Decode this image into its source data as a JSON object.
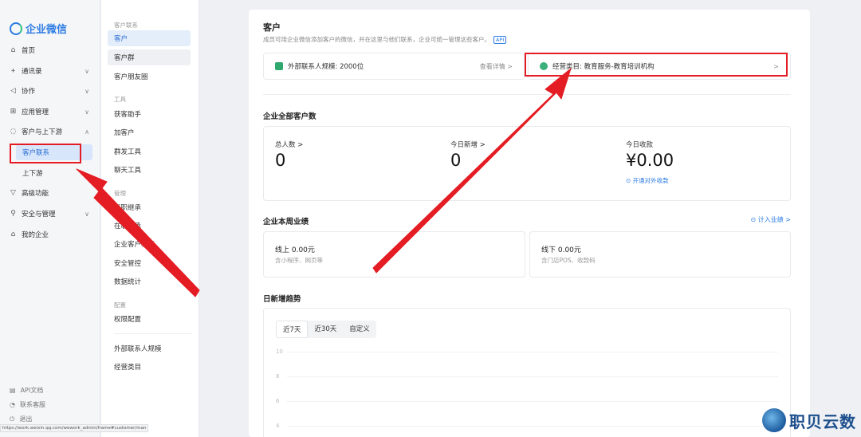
{
  "nav": {
    "logo": "企业微信",
    "items": [
      {
        "icon": "home-icon",
        "glyph": "⌂",
        "label": "首页"
      },
      {
        "icon": "org-icon",
        "glyph": "ᚐ",
        "label": "通讯录",
        "chev": "∨"
      },
      {
        "icon": "collab-icon",
        "glyph": "◁",
        "label": "协作",
        "chev": "∨"
      },
      {
        "icon": "apps-icon",
        "glyph": "⊞",
        "label": "应用管理",
        "chev": "∨"
      },
      {
        "icon": "chat-icon",
        "glyph": "◌",
        "label": "客户与上下游",
        "chev": "∧"
      }
    ],
    "sub_items": [
      "客户联系",
      "上下游"
    ],
    "items2": [
      {
        "icon": "advanced-icon",
        "glyph": "▽",
        "label": "高级功能"
      },
      {
        "icon": "security-icon",
        "glyph": "⚲",
        "label": "安全与管理",
        "chev": "∨"
      },
      {
        "icon": "company-icon",
        "glyph": "⌂",
        "label": "我的企业"
      }
    ],
    "footer": [
      {
        "icon": "doc-icon",
        "glyph": "▤",
        "label": "API文档"
      },
      {
        "icon": "service-icon",
        "glyph": "◔",
        "label": "联系客服"
      },
      {
        "icon": "logout-icon",
        "glyph": "⏻",
        "label": "退出"
      }
    ]
  },
  "sub": {
    "section1": "客户联系",
    "items1": [
      "客户",
      "客户群",
      "客户朋友圈"
    ],
    "section2": "工具",
    "items2": [
      "获客助手",
      "加客户",
      "群发工具",
      "聊天工具"
    ],
    "section3": "管理",
    "items3": [
      "离职继承",
      "在职继承",
      "企业客户标签",
      "安全管控",
      "数据统计"
    ],
    "section4": "配置",
    "items4": [
      "权限配置"
    ],
    "items5": [
      "外部联系人规模",
      "经营类目"
    ]
  },
  "main": {
    "title": "客户",
    "desc": "成员可用企业微信添加客户的微信，并在这里与他们联系，企业可统一管理这些客户。",
    "api_tag": "API",
    "scale_label": "外部联系人规模: 2000位",
    "scale_link": "查看详情 >",
    "category_label": "经营类目: 教育服务-教育培训机构",
    "category_chev": ">",
    "total_title": "企业全部客户数",
    "stats": [
      {
        "label": "总人数 >",
        "value": "0"
      },
      {
        "label": "今日新增 >",
        "value": "0"
      },
      {
        "label": "今日收款",
        "value": "¥0.00"
      }
    ],
    "open_payment": "⊙ 开通对外收款",
    "perf_title": "企业本周业绩",
    "perf_link": "⊙ 计入业绩 >",
    "online_label": "线上 0.00元",
    "online_sub": "含小程序、网页等",
    "offline_label": "线下 0.00元",
    "offline_sub": "含门店POS、收款码",
    "trend_title": "日新增趋势",
    "tabs": [
      "近7天",
      "近30天",
      "自定义"
    ],
    "y_ticks": [
      "10",
      "8",
      "6",
      "4"
    ]
  },
  "status_url": "https://work.weixin.qq.com/wework_admin/frame#customer/man",
  "brand": "职贝云数",
  "accent": "#2b7be4",
  "annotation_color": "#e41c23"
}
